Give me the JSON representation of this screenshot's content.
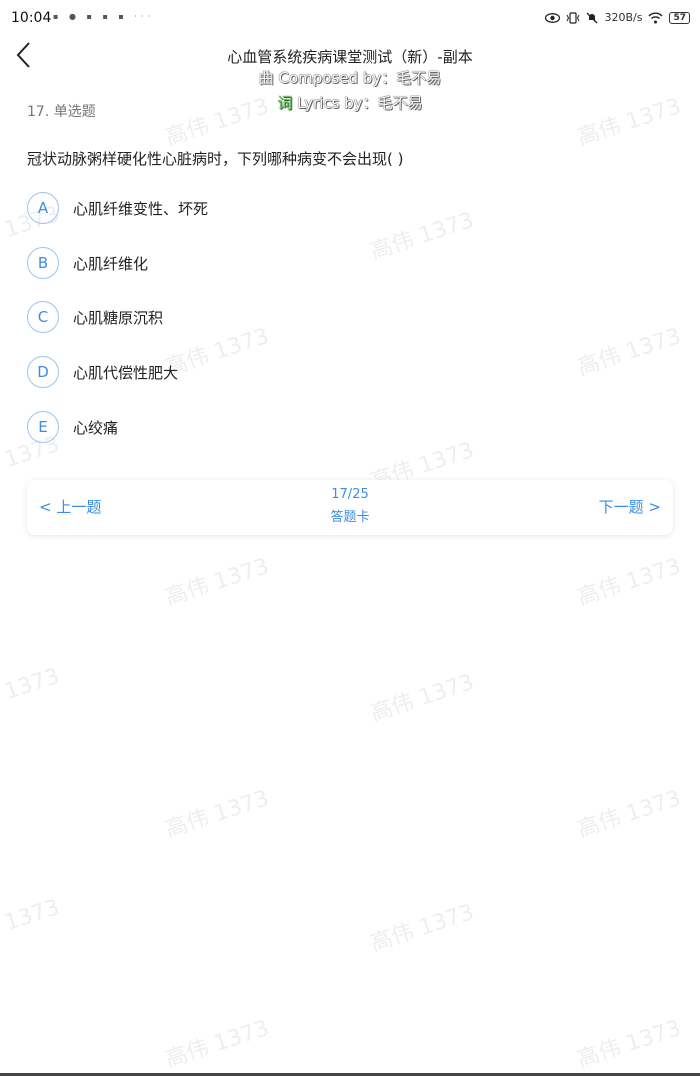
{
  "status_bar": {
    "time": "10:04",
    "left_icons": "▪ ● ▪ ▪ ▪ ···",
    "net_speed": "320B/s",
    "battery": "57"
  },
  "header": {
    "title": "心血管系统疾病课堂测试（新）-副本",
    "lyric_1_prefix": "曲",
    "lyric_1_text": " Composed by：毛不易",
    "lyric_2_prefix": "词",
    "lyric_2_text": " Lyrics by：毛不易"
  },
  "question": {
    "type_label": "17. 单选题",
    "stem": "冠状动脉粥样硬化性心脏病时，下列哪种病变不会出现( )",
    "options": [
      {
        "letter": "A",
        "text": "心肌纤维变性、坏死"
      },
      {
        "letter": "B",
        "text": "心肌纤维化"
      },
      {
        "letter": "C",
        "text": "心肌糖原沉积"
      },
      {
        "letter": "D",
        "text": "心肌代偿性肥大"
      },
      {
        "letter": "E",
        "text": "心绞痛"
      }
    ]
  },
  "nav": {
    "prev_label": "< 上一题",
    "next_label": "下一题 >",
    "progress": "17/25",
    "answer_card_label": "答题卡"
  },
  "watermark": {
    "name_text": "高伟 1373",
    "number_text": "1373"
  }
}
